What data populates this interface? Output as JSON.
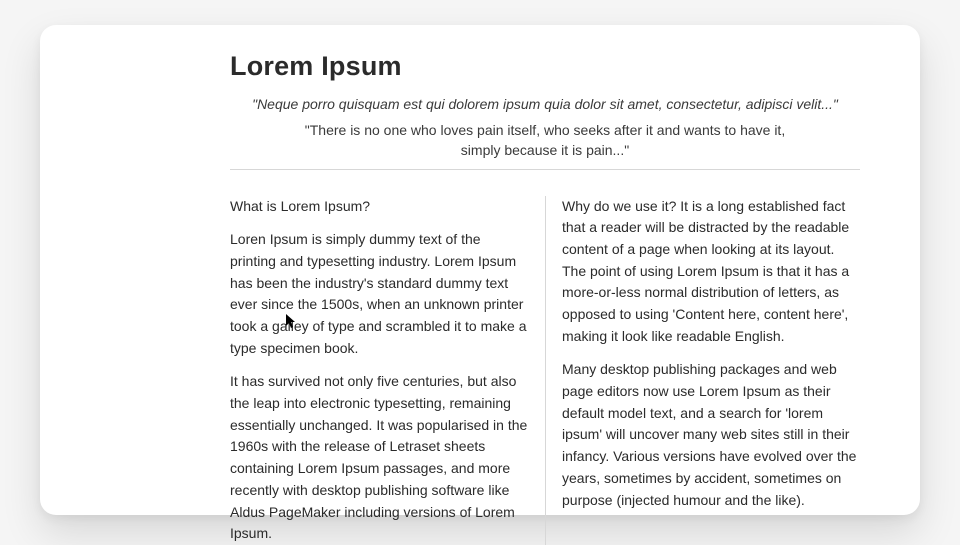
{
  "header": {
    "title": "Lorem Ipsum",
    "quote_italic": "\"Neque porro quisquam est qui dolorem ipsum quia dolor sit amet, consectetur, adipisci velit...\"",
    "quote_plain": "\"There is no one who loves pain itself, who seeks after it and wants to have it, simply because it is pain...\""
  },
  "body": {
    "col1_p1": "What is Lorem Ipsum?",
    "col1_p2": "Loren Ipsum is simply dummy text of the printing and typesetting industry. Lorem Ipsum has been the industry's standard dummy text ever since the 1500s, when an unknown printer took a galley of type and scrambled it to make a type specimen book.",
    "col1_p3": "It has survived not only five centuries, but also the leap into electronic typesetting, remaining essentially unchanged. It was popularised in the 1960s with the release of Letraset sheets containing Lorem Ipsum passages, and more recently with desktop publishing software like Aldus PageMaker including versions of Lorem Ipsum.",
    "col2_p1": "Why do we use it? It is a long established fact that a reader will be distracted by the readable content of a page when looking at its layout. The point of using Lorem Ipsum is that it has a more-or-less normal distribution of letters, as opposed to using 'Content here, content here', making it look like readable English.",
    "col2_p2": " Many desktop publishing packages and web page editors now use Lorem Ipsum as their default model text, and a search for 'lorem ipsum' will uncover many web sites still in their infancy. Various versions have evolved over the years, sometimes by accident, sometimes on purpose (injected humour and the like)."
  }
}
